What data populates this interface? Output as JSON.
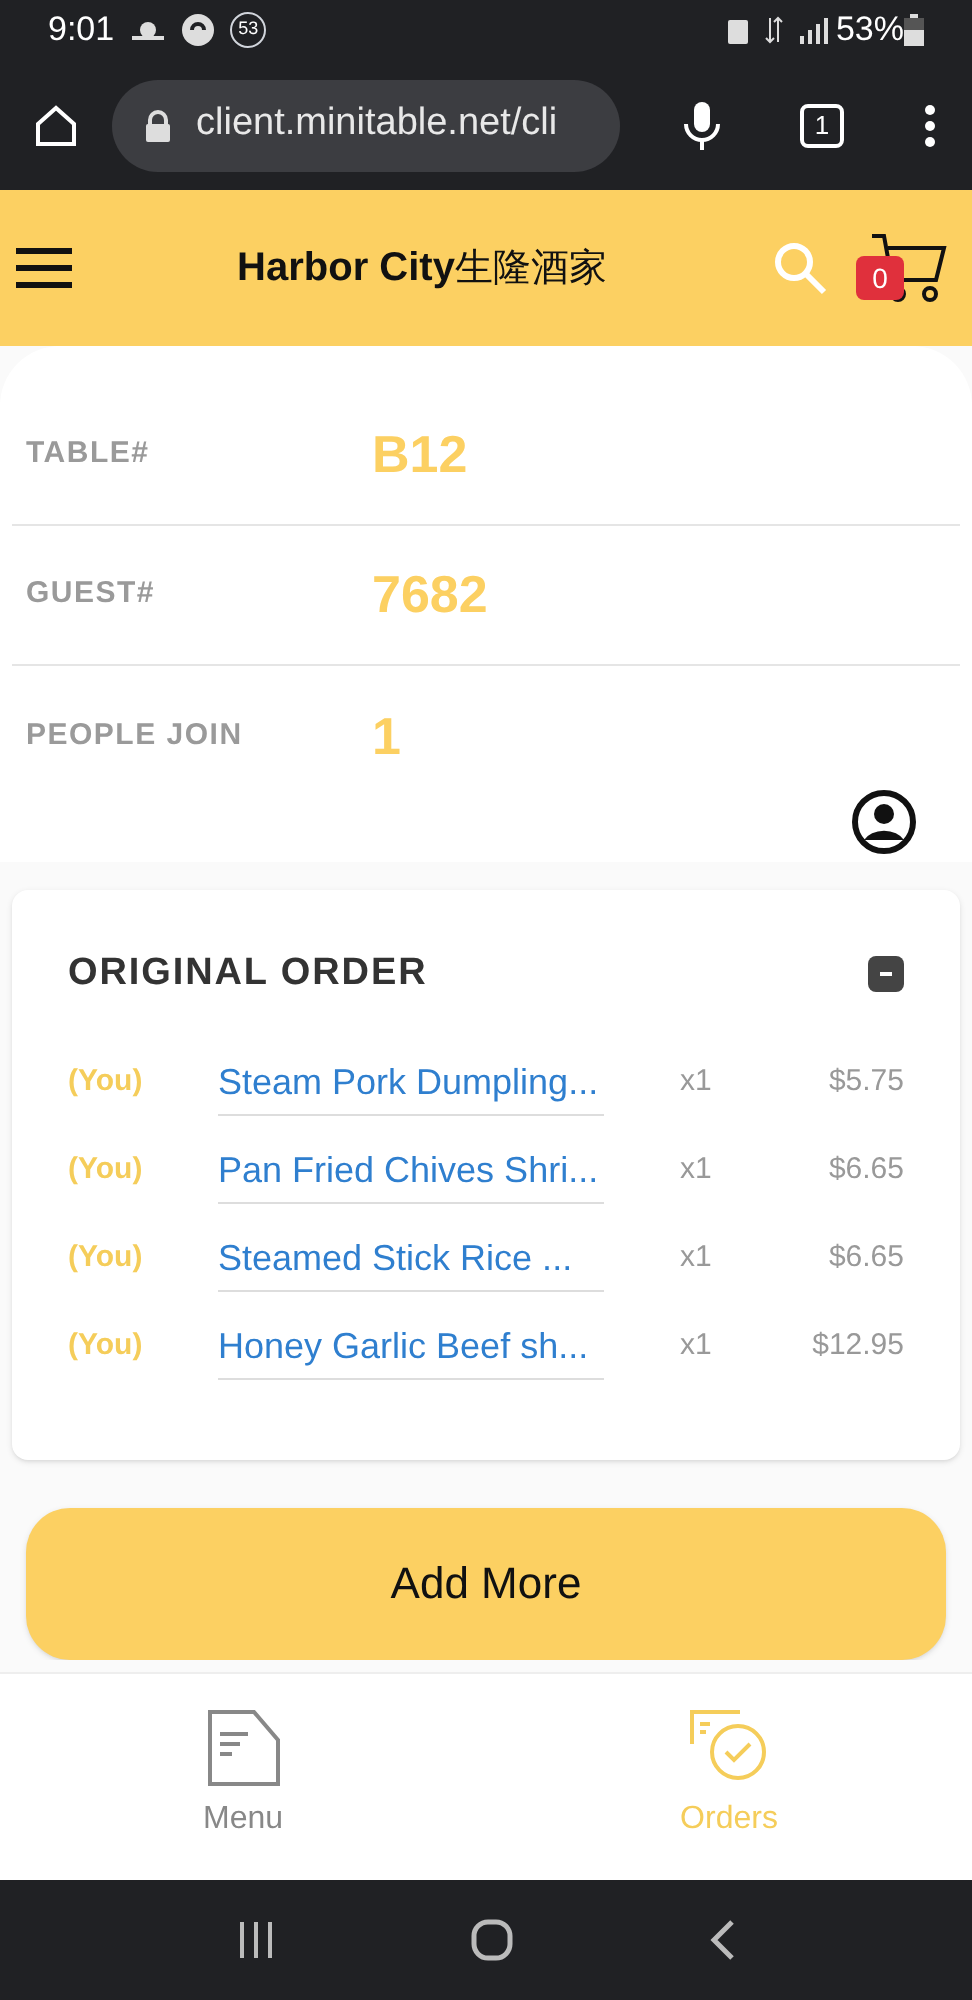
{
  "status_bar": {
    "time": "9:01",
    "notification_count": "53",
    "battery": "53%"
  },
  "browser": {
    "url": "client.minitable.net/cli",
    "tab_count": "1"
  },
  "header": {
    "title": "Harbor City",
    "title_cjk": "生隆酒家",
    "cart_count": "0"
  },
  "info": [
    {
      "label": "TABLE#",
      "value": "B12"
    },
    {
      "label": "GUEST#",
      "value": "7682"
    },
    {
      "label": "PEOPLE JOIN",
      "value": "1"
    }
  ],
  "order": {
    "title": "ORIGINAL ORDER",
    "expanded": true,
    "items": [
      {
        "who": "(You)",
        "name": "Steam Pork Dumpling...",
        "qty": "x1",
        "price": "$5.75"
      },
      {
        "who": "(You)",
        "name": "Pan Fried Chives Shri...",
        "qty": "x1",
        "price": "$6.65"
      },
      {
        "who": "(You)",
        "name": "Steamed Stick Rice ...",
        "qty": "x1",
        "price": "$6.65"
      },
      {
        "who": "(You)",
        "name": "Honey Garlic Beef sh...",
        "qty": "x1",
        "price": "$12.95"
      }
    ]
  },
  "add_button": "Add More",
  "bottom_nav": [
    {
      "label": "Menu",
      "kind": "menu",
      "selected": false
    },
    {
      "label": "Orders",
      "kind": "orders",
      "selected": true
    }
  ]
}
